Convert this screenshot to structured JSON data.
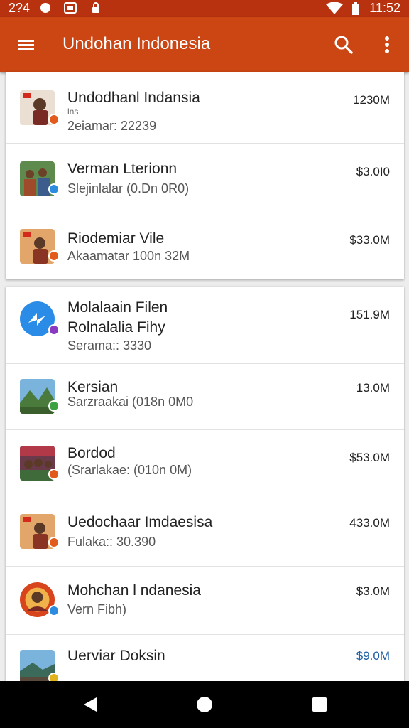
{
  "status_bar": {
    "time_left": "2?4",
    "time_right": "11:52",
    "icons": [
      "circle-icon",
      "gallery-icon",
      "lock-icon",
      "wifi-icon",
      "battery-icon"
    ]
  },
  "app_bar": {
    "title": "Undohan Indonesia",
    "icons": [
      "menu-icon",
      "search-icon",
      "more-vert-icon"
    ]
  },
  "list_card_1": [
    {
      "name": "Undodhanl Indansia",
      "small": "lns",
      "sub": "2eiamar: 22239",
      "amount": "1230M"
    },
    {
      "name": "Verman Lterionn",
      "sub": "Slejinlalar (0.Dn 0R0)",
      "amount": "$3.0I0"
    },
    {
      "name": "Riodemiar Vile",
      "sub": "Akaamatar 100n 32M",
      "amount": "$33.0M"
    }
  ],
  "list_card_2": [
    {
      "name": "Molalaain Filen",
      "name2": "Rolnalalia Fihy",
      "sub": "Serama:: 3330",
      "amount": "151.9M"
    },
    {
      "name": "Kersian",
      "sub": "Sarzraakai (018n 0M0",
      "amount": "13.0M"
    },
    {
      "name": "Bordod",
      "sub": "(Srarlakae: (010n 0M)",
      "amount": "$53.0M"
    },
    {
      "name": "Uedochaar Imdaesisa",
      "sub": "Fulaka:: 30.390",
      "amount": "433.0M"
    },
    {
      "name": "Mohchan l ndanesia",
      "sub": "Vern Fibh)",
      "amount": "$3.0M"
    },
    {
      "name": "Uerviar Doksin",
      "sub": "",
      "amount": "$9.0M"
    }
  ],
  "colors": {
    "status_bar": "#b8320f",
    "app_bar": "#cc4614",
    "background": "#ededed",
    "card": "#ffffff",
    "last_amount": "#1f5fa8"
  },
  "nav_bar": {
    "icons": [
      "back-icon",
      "home-icon",
      "recents-icon"
    ]
  }
}
